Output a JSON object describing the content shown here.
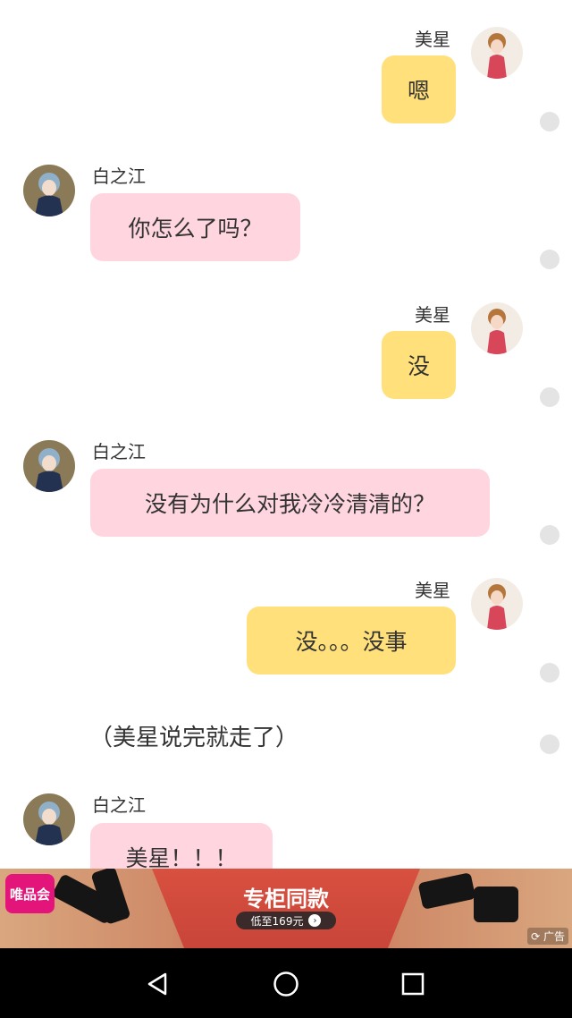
{
  "messages": [
    {
      "sender": "美星",
      "text": "嗯"
    },
    {
      "sender": "白之江",
      "text": "你怎么了吗？"
    },
    {
      "sender": "美星",
      "text": "没"
    },
    {
      "sender": "白之江",
      "text": "没有为什么对我冷冷清清的？"
    },
    {
      "sender": "美星",
      "text": "没。。。没事"
    },
    {
      "sender": "白之江",
      "text": "美星！！！"
    }
  ],
  "narration": "（美星说完就走了）",
  "ad": {
    "brand": "唯品会",
    "title": "专柜同款",
    "price_text": "低至169元",
    "tag": "广告"
  },
  "colors": {
    "pink_bubble": "#ffd6e0",
    "yellow_bubble": "#ffe07a",
    "ad_red": "#d8503f",
    "brand_pink": "#e4157a"
  },
  "icons": [
    "back-icon",
    "home-icon",
    "recents-icon",
    "arrow-right-icon",
    "refresh-icon"
  ]
}
